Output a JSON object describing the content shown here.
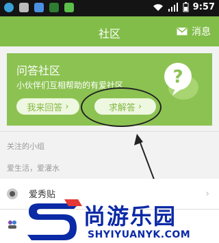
{
  "status": {
    "time": "9:57"
  },
  "appbar": {
    "title": "社区",
    "messages": "消息"
  },
  "qa": {
    "title": "问答社区",
    "subtitle": "小伙伴们互相帮助的有爱社区",
    "answer_btn": "我来回答",
    "ask_btn": "求解答"
  },
  "sections": {
    "followed": "关注的小组",
    "love": "爱生活，爱灌水"
  },
  "list": {
    "item1": "爱秀贴"
  },
  "watermark": {
    "brand": "尚游乐园",
    "url": "SHYIYUANYK.COM"
  },
  "colors": {
    "green": "#82bd4a",
    "card": "#8cc252",
    "brand_blue": "#0b2aa6"
  }
}
